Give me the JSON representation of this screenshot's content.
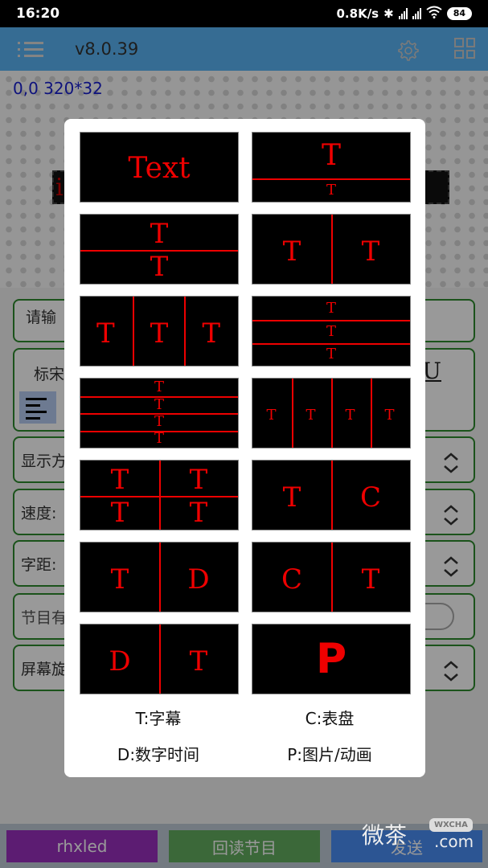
{
  "status_bar": {
    "time": "16:20",
    "net_speed": "0.8K/s",
    "icons": [
      "bluetooth-icon",
      "hd-signal-icon",
      "hd-signal-icon",
      "wifi-icon"
    ],
    "battery": "84"
  },
  "app_bar": {
    "menu_icon": "menu-list-icon",
    "version": "v8.0.39",
    "settings_icon": "gear-icon",
    "layout_icon": "grid-icon"
  },
  "canvas": {
    "coords": "0,0 320*32",
    "preview_char": "i"
  },
  "form": {
    "input_placeholder": "请输",
    "font_label": "标宋",
    "underline_glyph": "U",
    "display_label": "显示方",
    "speed_label": "速度:",
    "spacing_label": "字距:",
    "program_label": "节目有",
    "rotation_label": "屏幕旋"
  },
  "bottom_bar": {
    "buttons": [
      {
        "label": "rhxled",
        "color": "#9a2fbf"
      },
      {
        "label": "回读节目",
        "color": "#63ad5f"
      },
      {
        "label": "发送",
        "color": "#4a8ef5"
      }
    ]
  },
  "watermark": {
    "text": "微茶",
    "badge": "WXCHA",
    "suffix": ".com"
  },
  "layout_picker": {
    "tiles": [
      {
        "name": "single-text",
        "glyphs": [
          "Text"
        ]
      },
      {
        "name": "top-large-bottom-small",
        "glyphs": [
          "T",
          "T"
        ]
      },
      {
        "name": "two-rows",
        "glyphs": [
          "T",
          "T"
        ]
      },
      {
        "name": "two-columns",
        "glyphs": [
          "T",
          "T"
        ]
      },
      {
        "name": "three-columns",
        "glyphs": [
          "T",
          "T",
          "T"
        ]
      },
      {
        "name": "three-rows",
        "glyphs": [
          "T",
          "T",
          "T"
        ]
      },
      {
        "name": "four-rows",
        "glyphs": [
          "T",
          "T",
          "T",
          "T"
        ]
      },
      {
        "name": "four-columns",
        "glyphs": [
          "T",
          "T",
          "T",
          "T"
        ]
      },
      {
        "name": "quad-grid",
        "glyphs": [
          "T",
          "T",
          "T",
          "T"
        ]
      },
      {
        "name": "text-clock",
        "glyphs": [
          "T",
          "C"
        ]
      },
      {
        "name": "text-digital",
        "glyphs": [
          "T",
          "D"
        ]
      },
      {
        "name": "clock-text",
        "glyphs": [
          "C",
          "T"
        ]
      },
      {
        "name": "digital-text",
        "glyphs": [
          "D",
          "T"
        ]
      },
      {
        "name": "picture",
        "glyphs": [
          "P"
        ]
      }
    ],
    "legend": {
      "t": "T:字幕",
      "c": "C:表盘",
      "d": "D:数字时间",
      "p": "P:图片/动画"
    }
  }
}
